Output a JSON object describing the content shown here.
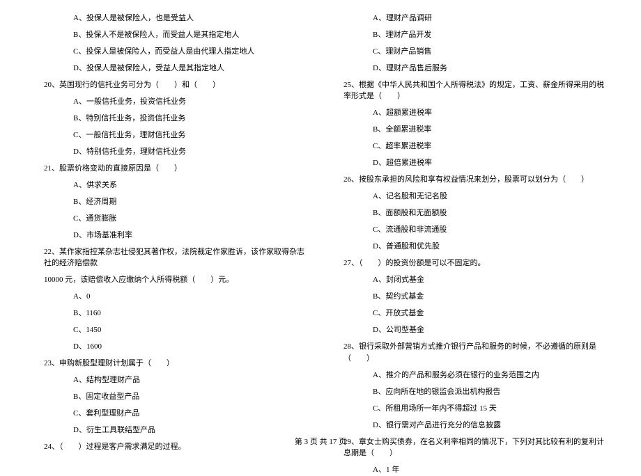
{
  "left_column": {
    "q19_options": [
      "A、投保人是被保险人，也是受益人",
      "B、投保人不是被保险人，而受益人是其指定地人",
      "C、投保人是被保险人，而受益人是由代理人指定地人",
      "D、投保人是被保险人，受益人是其指定地人"
    ],
    "q20": "20、英国现行的信托业务可分为（　　）和（　　）",
    "q20_options": [
      "A、一般信托业务，投资信托业务",
      "B、特别信托业务，投资信托业务",
      "C、一般信托业务，理财信托业务",
      "D、特别信托业务，理财信托业务"
    ],
    "q21": "21、股票价格变动的直接原因是（　　）",
    "q21_options": [
      "A、供求关系",
      "B、经济周期",
      "C、通货膨胀",
      "D、市场基准利率"
    ],
    "q22": "22、某作家指控某杂志社侵犯其著作权，法院裁定作家胜诉，该作家取得杂志社的经济赔偿款",
    "q22_sub": "10000 元，该赔偿收入应缴纳个人所得税额（　　）元。",
    "q22_options": [
      "A、0",
      "B、1160",
      "C、1450",
      "D、1600"
    ],
    "q23": "23、申购新股型理财计划属于（　　）",
    "q23_options": [
      "A、结构型理财产品",
      "B、固定收益型产品",
      "C、套利型理财产品",
      "D、衍生工具联结型产品"
    ],
    "q24": "24、（　　）过程是客户需求满足的过程。"
  },
  "right_column": {
    "q24_options": [
      "A、理财产品调研",
      "B、理财产品开发",
      "C、理财产品销售",
      "D、理财产品售后服务"
    ],
    "q25": "25、根据《中华人民共和国个人所得税法》的规定，工资、薪金所得采用的税率形式是（　　）",
    "q25_options": [
      "A、超额累进税率",
      "B、全额累进税率",
      "C、超率累进税率",
      "D、超倍累进税率"
    ],
    "q26": "26、按股东承担的风险和享有权益情况来划分，股票可以划分为（　　）",
    "q26_options": [
      "A、记名股和无记名股",
      "B、面额股和无面额股",
      "C、流通股和非流通股",
      "D、普通股和优先股"
    ],
    "q27": "27、（　　）的投资份额是可以不固定的。",
    "q27_options": [
      "A、封闭式基金",
      "B、契约式基金",
      "C、开放式基金",
      "D、公司型基金"
    ],
    "q28": "28、银行采取外部营销方式推介银行产品和服务的时候，不必遵循的原则是（　　）",
    "q28_options": [
      "A、推介的产品和服务必须在银行的业务范围之内",
      "B、应向所在地的银监会派出机构报告",
      "C、所租用场所一年内不得超过 15 天",
      "D、银行需对产品进行充分的信息披露"
    ],
    "q29": "29、章女士购买债券，在名义利率相同的情况下，下列对其比较有利的复利计息期是（　　）",
    "q29_options": [
      "A、1 年"
    ]
  },
  "footer": "第 3 页 共 17 页"
}
